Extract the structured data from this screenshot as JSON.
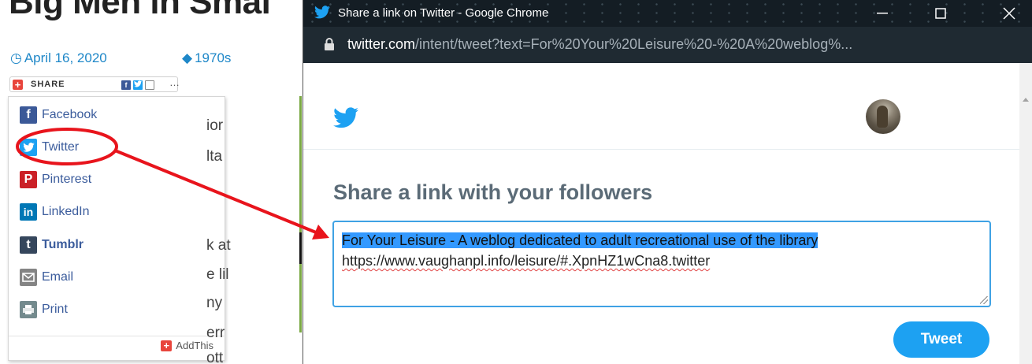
{
  "blog": {
    "title": "Big Men in Smal",
    "date": "April 16, 2020",
    "category": "1970s",
    "share_label": "SHARE",
    "share_more": "…",
    "menu": [
      {
        "label": "Facebook",
        "icon": "facebook-icon",
        "color": "#3b5998",
        "glyph": "f"
      },
      {
        "label": "Twitter",
        "icon": "twitter-icon",
        "color": "#1da1f2",
        "glyph": ""
      },
      {
        "label": "Pinterest",
        "icon": "pinterest-icon",
        "color": "#cb2027",
        "glyph": "P"
      },
      {
        "label": "LinkedIn",
        "icon": "linkedin-icon",
        "color": "#0077b5",
        "glyph": "in"
      },
      {
        "label": "Tumblr",
        "icon": "tumblr-icon",
        "color": "#35465c",
        "glyph": "t"
      },
      {
        "label": "Email",
        "icon": "email-icon",
        "color": "#848484",
        "glyph": ""
      },
      {
        "label": "Print",
        "icon": "print-icon",
        "color": "#738a8d",
        "glyph": ""
      }
    ],
    "addthis_label": "AddThis",
    "body_fragments": [
      "ior",
      "lta",
      "k at",
      "e lil",
      "ny",
      "err",
      "ott"
    ]
  },
  "popup": {
    "window_title": "Share a link on Twitter - Google Chrome",
    "url_host": "twitter.com",
    "url_path": "/intent/tweet?text=For%20Your%20Leisure%20-%20A%20weblog%...",
    "heading": "Share a link with your followers",
    "tweet_text_line1": "For Your Leisure - A weblog dedicated to adult recreational use of the library",
    "tweet_text_line2": "https://www.vaughanpl.info/leisure/#.XpnHZ1wCna8.twitter",
    "tweet_button": "Tweet"
  },
  "colors": {
    "twitter_blue": "#1da1f2",
    "annotation_red": "#e8141c",
    "link_blue": "#1e87c8",
    "selection_blue": "#3399ff"
  }
}
